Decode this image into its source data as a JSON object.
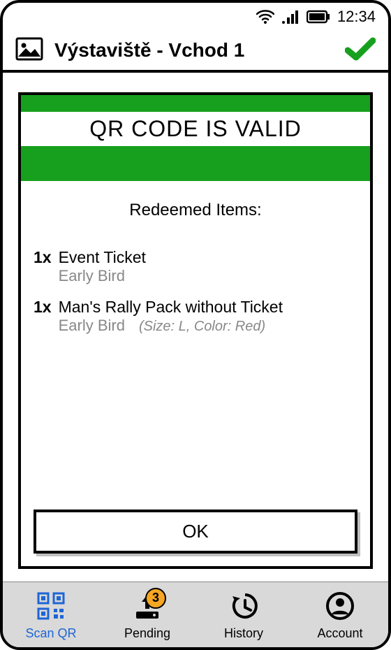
{
  "status_bar": {
    "time": "12:34"
  },
  "header": {
    "title": "Výstaviště - Vchod 1"
  },
  "banner": {
    "title": "QR CODE IS VALID",
    "color": "#17a01d"
  },
  "redeemed": {
    "label": "Redeemed Items:",
    "items": [
      {
        "qty": "1x",
        "name": "Event Ticket",
        "sub": "Early Bird",
        "detail": ""
      },
      {
        "qty": "1x",
        "name": "Man's Rally Pack without Ticket",
        "sub": "Early Bird",
        "detail": "(Size: L, Color: Red)"
      }
    ]
  },
  "ok_button": {
    "label": "OK"
  },
  "nav": {
    "scan": {
      "label": "Scan QR"
    },
    "pending": {
      "label": "Pending",
      "badge": "3"
    },
    "history": {
      "label": "History"
    },
    "account": {
      "label": "Account"
    }
  }
}
